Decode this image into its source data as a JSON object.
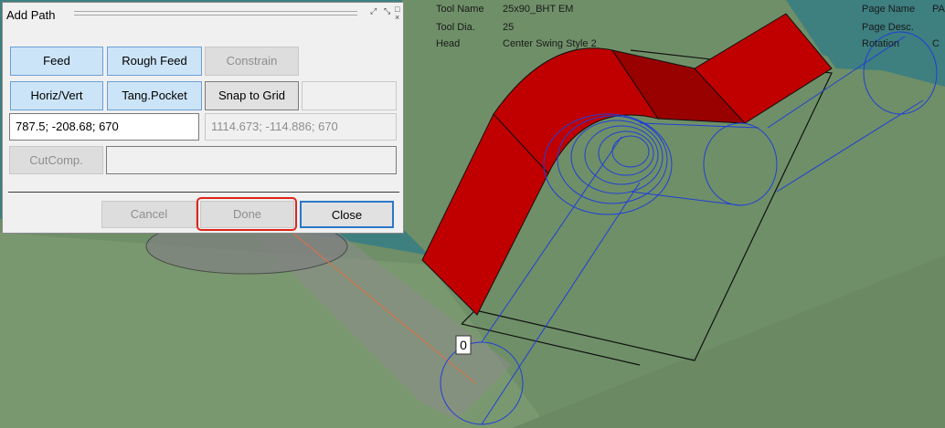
{
  "dialog": {
    "title": "Add Path",
    "buttons": {
      "feed": "Feed",
      "rough_feed": "Rough Feed",
      "constrain": "Constrain",
      "horiz_vert": "Horiz/Vert",
      "tang_pocket": "Tang.Pocket",
      "snap_to_grid": "Snap to Grid",
      "cut_comp": "CutComp.",
      "cancel": "Cancel",
      "done": "Done",
      "close": "Close"
    },
    "coord_input": "787.5; -208.68; 670",
    "coord_readout": "1114.673; -114.886; 670",
    "empty_field_1": "",
    "empty_field_2": ""
  },
  "tool_info": {
    "tool_name_label": "Tool Name",
    "tool_name_value": "25x90_BHT EM",
    "tool_dia_label": "Tool Dia.",
    "tool_dia_value": "25",
    "head_label": "Head",
    "head_value": "Center Swing Style 2"
  },
  "page_info": {
    "page_name_label": "Page Name",
    "page_name_value": "PA",
    "page_desc_label": "Page Desc.",
    "rotation_label": "Rotation",
    "rotation_value": "C"
  },
  "viewport": {
    "point_label": "0"
  },
  "colors": {
    "background_teal": "#3e7f80",
    "floor_green": "#6f8f68",
    "part_red": "#c00000",
    "toolpath_blue": "#1f3fd6",
    "done_highlight": "#e0241b"
  }
}
